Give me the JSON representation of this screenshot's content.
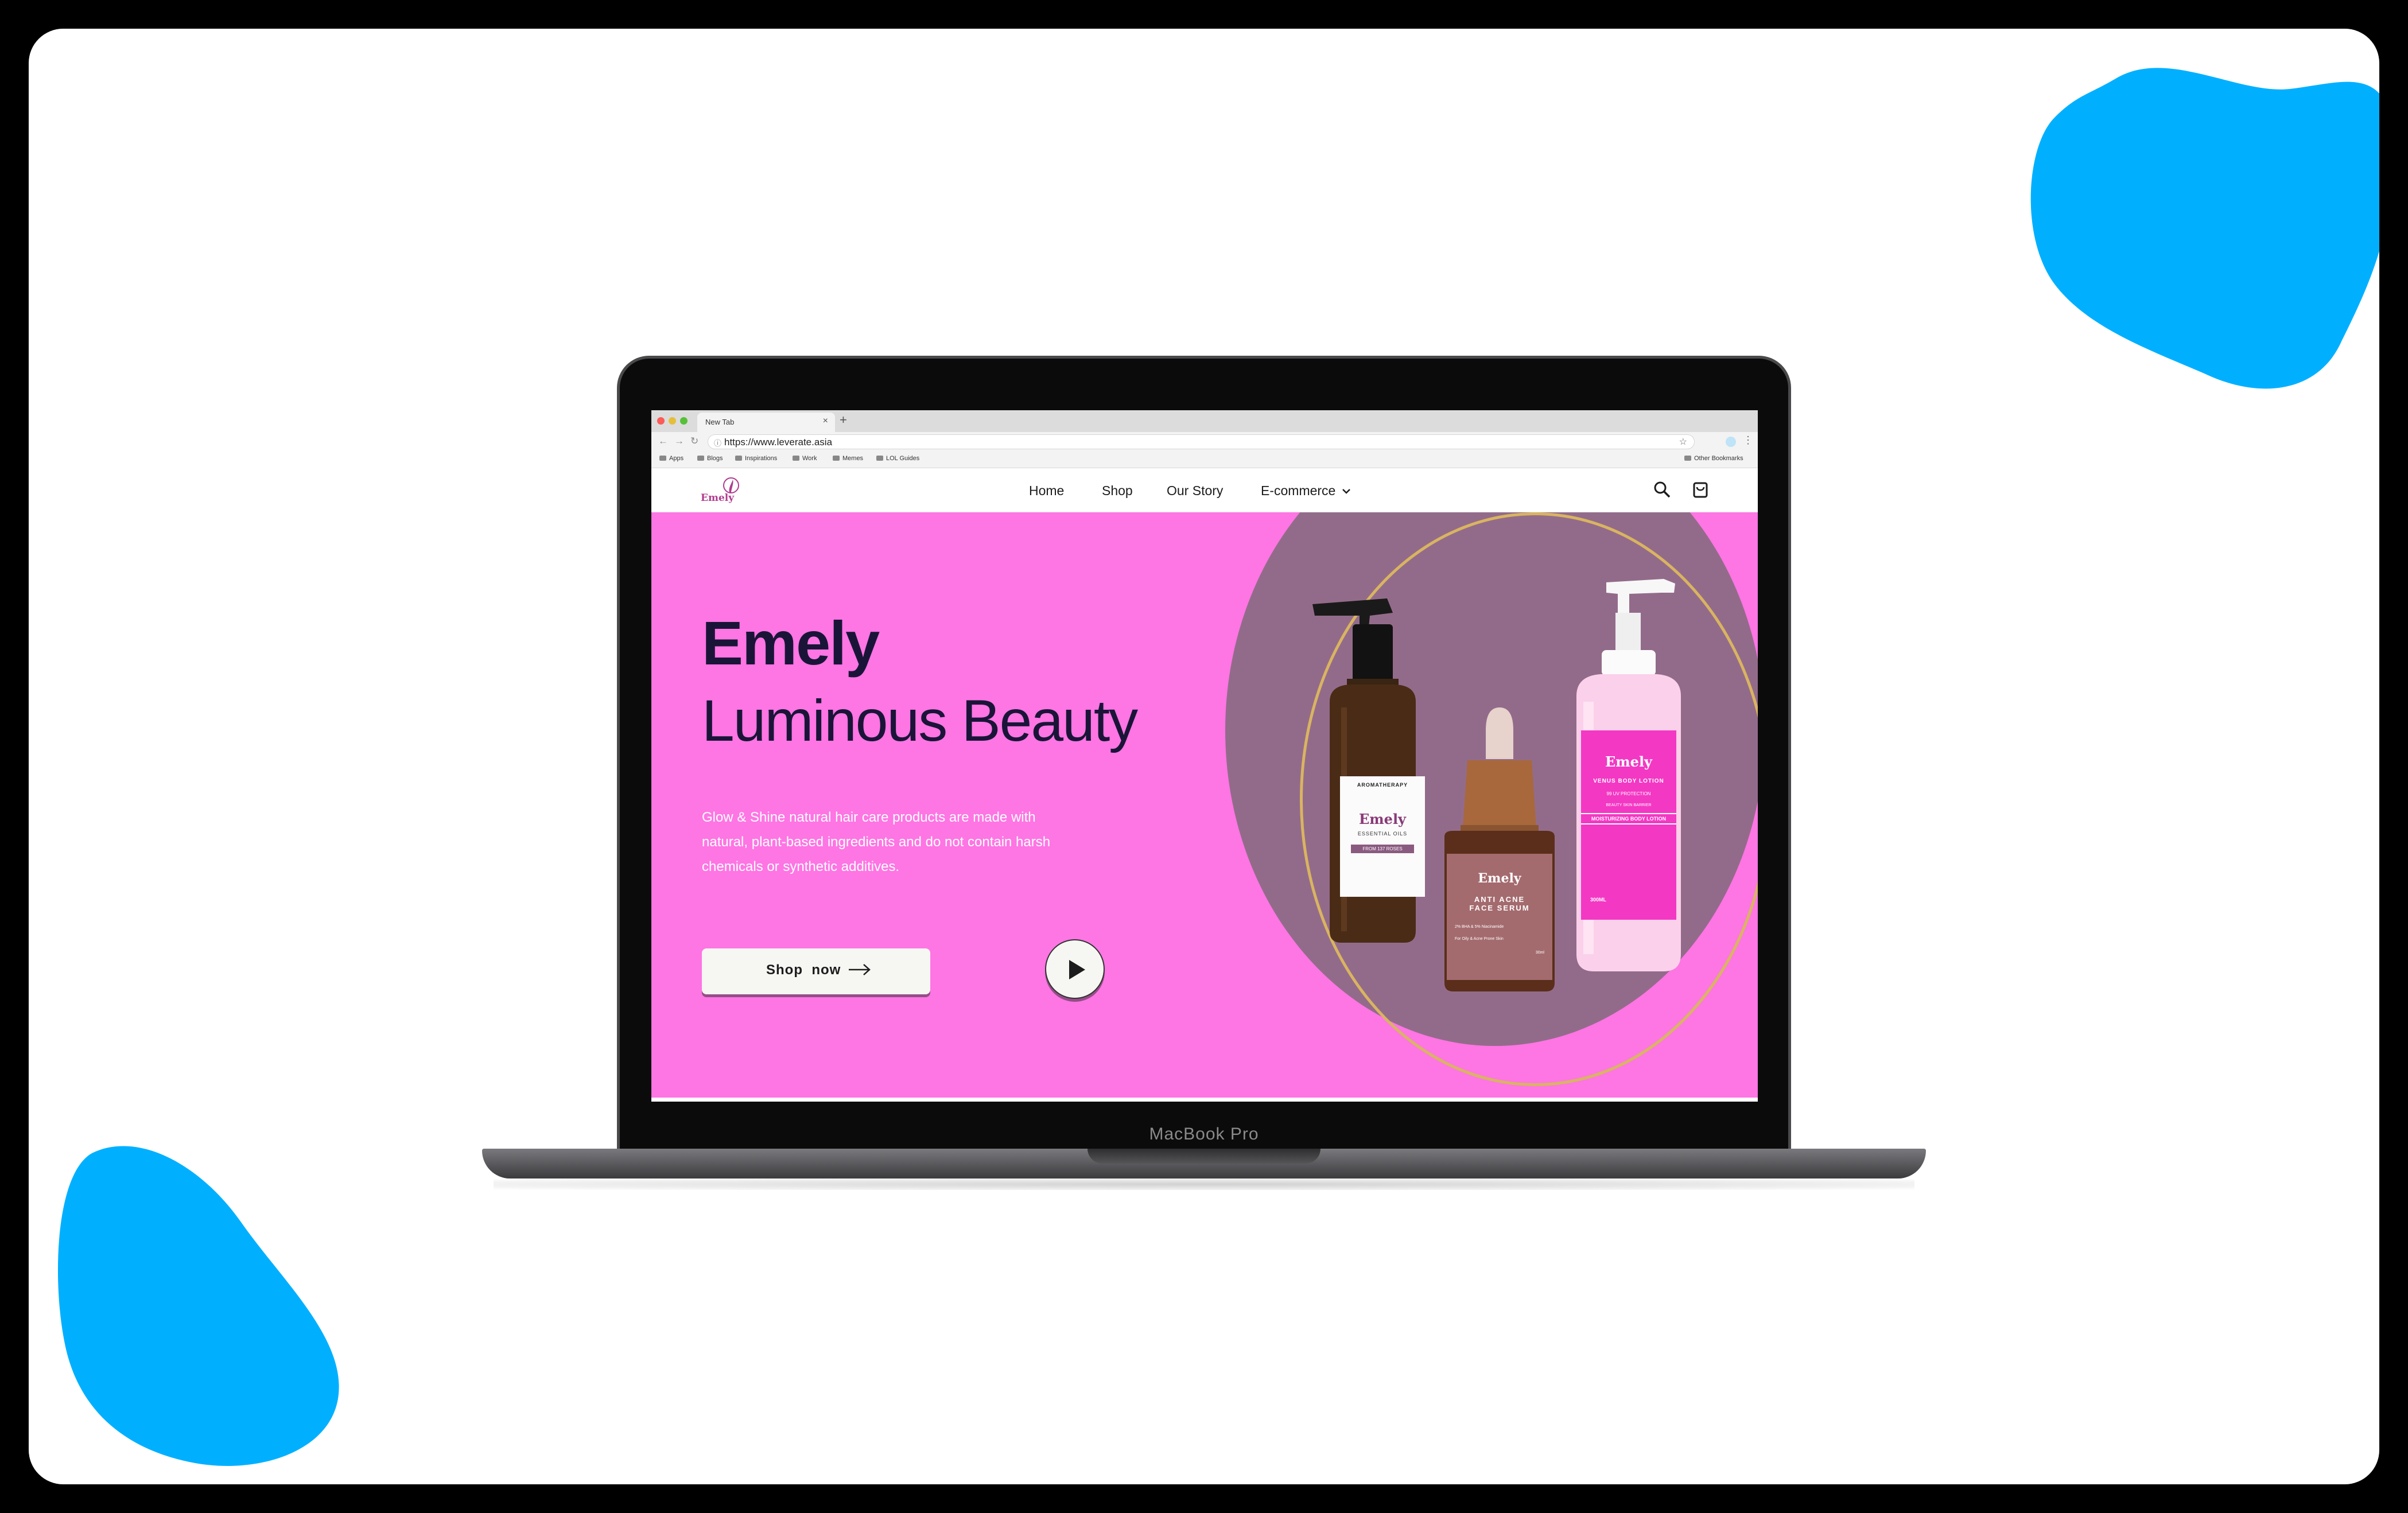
{
  "colors": {
    "frame_border": "#000000",
    "blob": "#00b0ff",
    "hero_bg": "#fe75e4",
    "hero_circle": "#936b8a",
    "heading": "#1a1538",
    "brand": "#b13b8f"
  },
  "device": {
    "label": "MacBook Pro"
  },
  "browser": {
    "tab_title": "New Tab",
    "url": "https://www.leverate.asia",
    "bookmarks": [
      "Apps",
      "Blogs",
      "Inspirations",
      "Work",
      "Memes",
      "LOL Guides"
    ],
    "other_bookmarks": "Other Bookmarks"
  },
  "site": {
    "logo_text": "Emely",
    "nav": {
      "home": "Home",
      "shop": "Shop",
      "our_story": "Our Story",
      "ecommerce": "E-commerce"
    },
    "icons": [
      "search-icon",
      "cart-icon",
      "chevron-down-icon"
    ]
  },
  "hero": {
    "title": "Emely",
    "subtitle": "Luminous Beauty",
    "description": "Glow & Shine natural hair care products are made with natural, plant-based ingredients and do not contain harsh chemicals or synthetic additives.",
    "shop_button": "Shop  now",
    "icons": [
      "arrow-right-icon",
      "play-icon"
    ]
  },
  "products": {
    "oil": {
      "line1": "AROMATHERAPY",
      "brand": "Emely",
      "name": "ESSENTIAL OILS",
      "tag": "FROM 137 ROSES"
    },
    "serum": {
      "brand": "Emely",
      "name_line1": "ANTI ACNE",
      "name_line2": "FACE SERUM",
      "detail": "2% BHA & 5% Niacinamide",
      "detail2": "For Oily & Acne Prone Skin",
      "size": "30ml"
    },
    "lotion": {
      "brand": "Emely",
      "name": "VENUS BODY LOTION",
      "sub": "99 UV PROTECTION",
      "sub2": "BEAUTY SKIN BARRIER",
      "band": "MOISTURIZING BODY LOTION",
      "size": "300ML"
    }
  }
}
